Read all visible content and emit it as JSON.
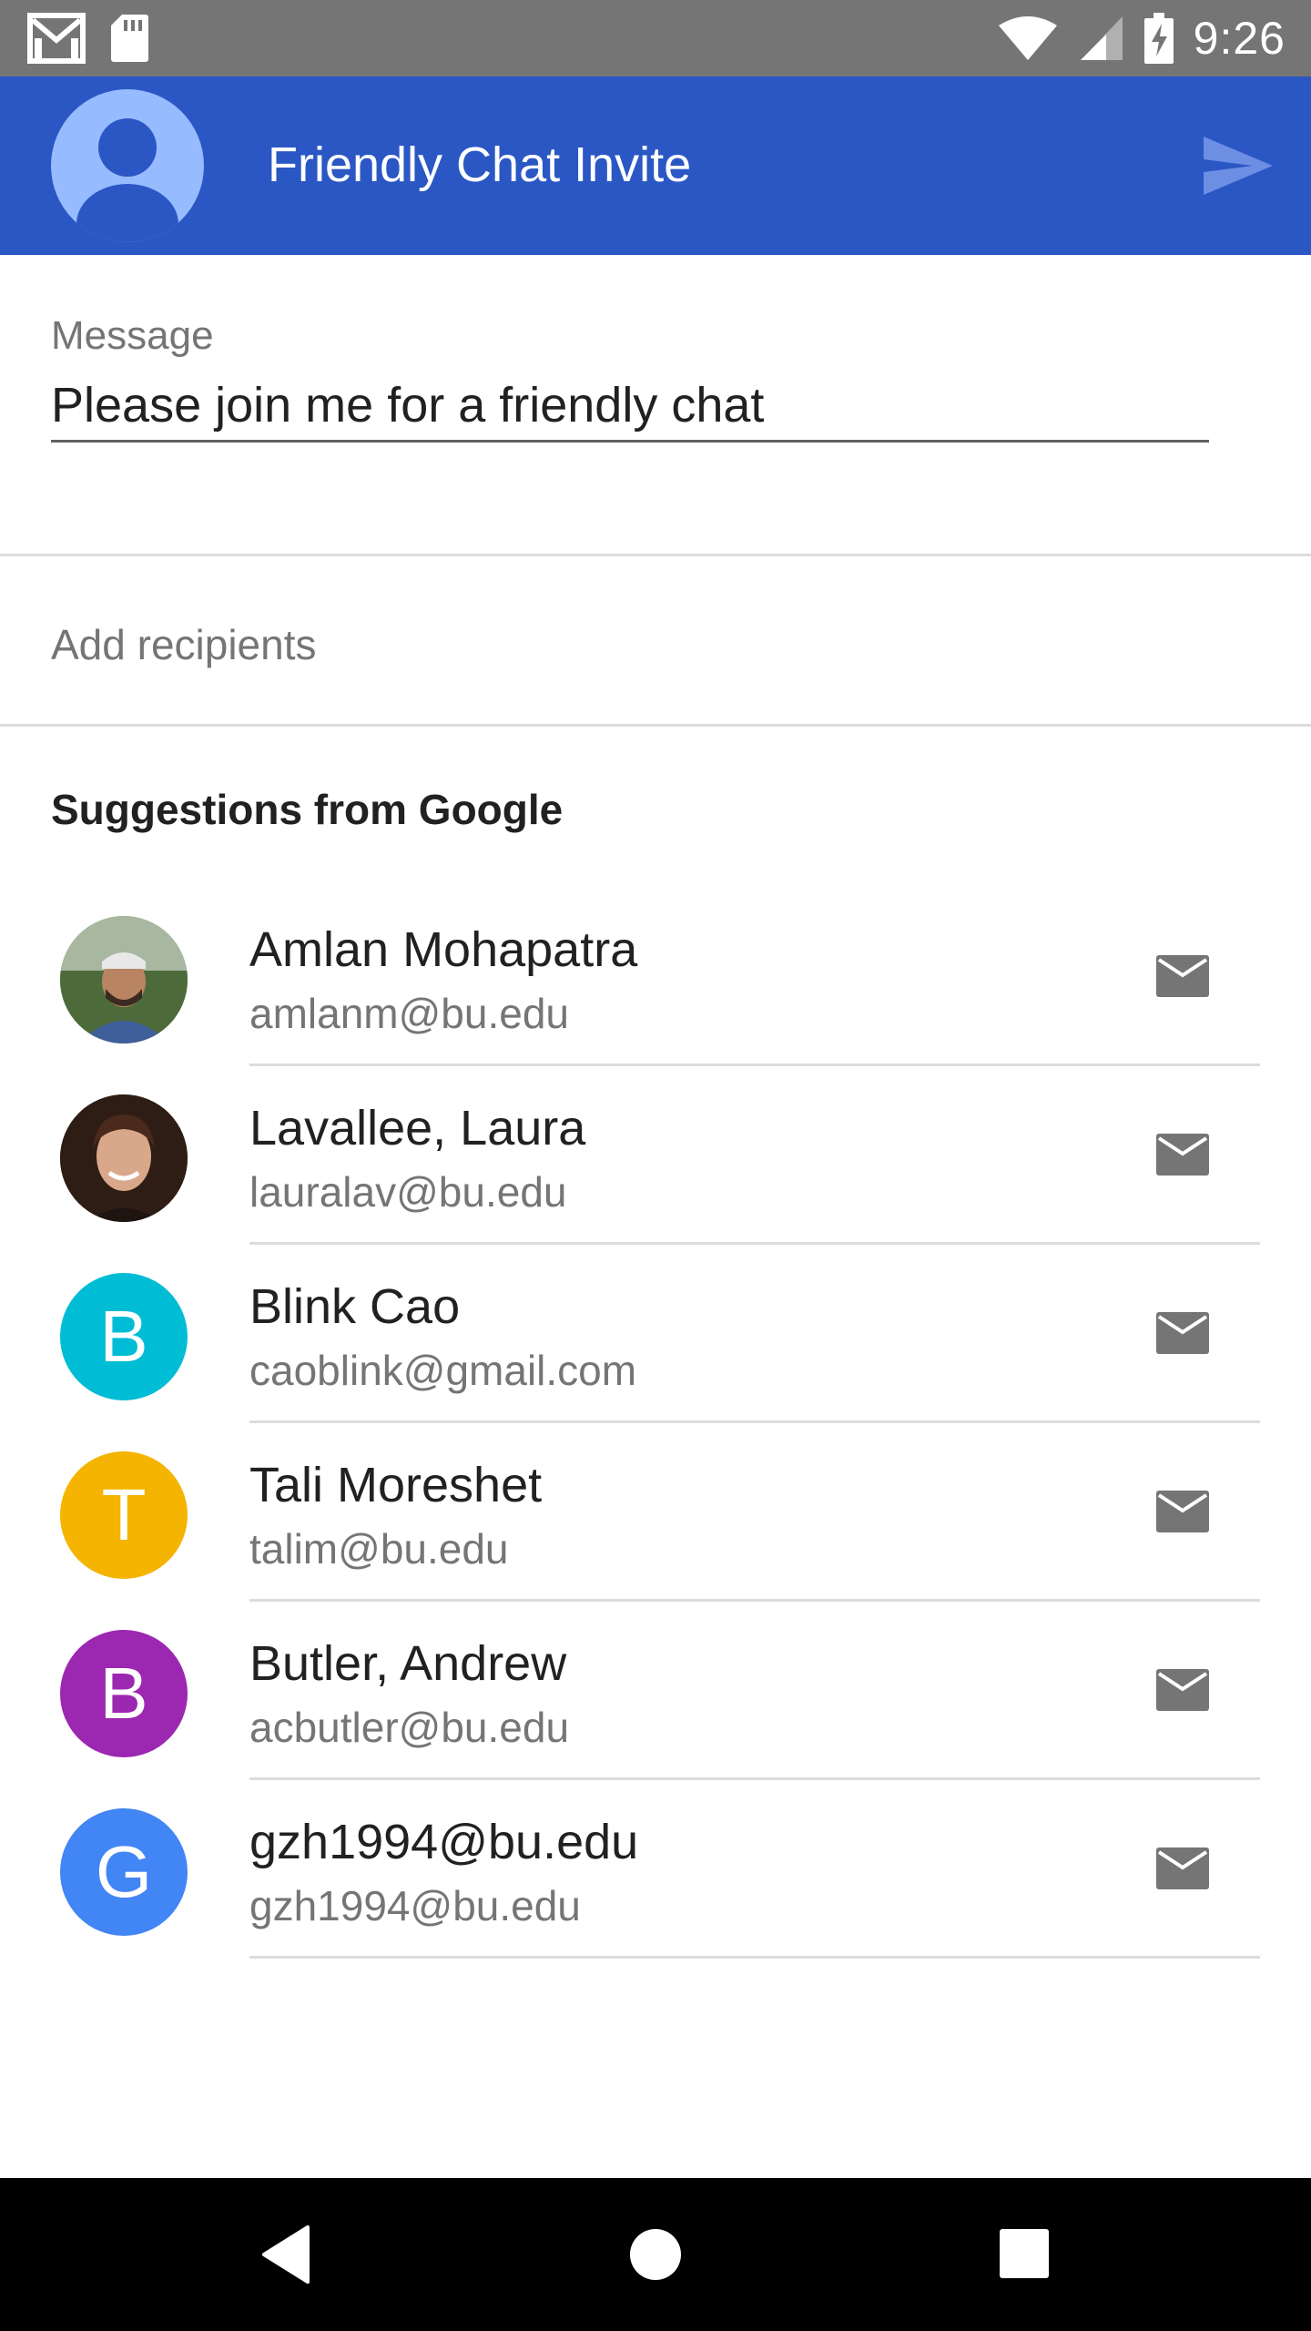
{
  "status_bar": {
    "time": "9:26",
    "left_icons": [
      "gmail-icon",
      "sd-card-icon"
    ],
    "right_icons": [
      "wifi-icon",
      "cell-signal-icon",
      "battery-charging-icon"
    ]
  },
  "app_bar": {
    "title": "Friendly Chat Invite",
    "background": "#2b57c4",
    "avatar_icon": "account-icon",
    "send_icon": "send-icon"
  },
  "message": {
    "label": "Message",
    "value": "Please join me for a friendly chat"
  },
  "recipients": {
    "placeholder": "Add recipients"
  },
  "suggestions": {
    "heading": "Suggestions from Google",
    "items": [
      {
        "name": "Amlan Mohapatra",
        "email": "amlanm@bu.edu",
        "avatar_type": "photo",
        "avatar_letter": "",
        "avatar_color": "#4a6a3a"
      },
      {
        "name": "Lavallee, Laura",
        "email": "lauralav@bu.edu",
        "avatar_type": "photo",
        "avatar_letter": "",
        "avatar_color": "#3a2418"
      },
      {
        "name": "Blink Cao",
        "email": "caoblink@gmail.com",
        "avatar_type": "letter",
        "avatar_letter": "B",
        "avatar_color": "#00bcd4"
      },
      {
        "name": "Tali Moreshet",
        "email": "talim@bu.edu",
        "avatar_type": "letter",
        "avatar_letter": "T",
        "avatar_color": "#f4b400"
      },
      {
        "name": "Butler, Andrew",
        "email": "acbutler@bu.edu",
        "avatar_type": "letter",
        "avatar_letter": "B",
        "avatar_color": "#9c27b0"
      },
      {
        "name": "gzh1994@bu.edu",
        "email": "gzh1994@bu.edu",
        "avatar_type": "letter",
        "avatar_letter": "G",
        "avatar_color": "#4285f4"
      }
    ]
  },
  "nav_bar": {
    "buttons": [
      "back-icon",
      "home-icon",
      "recents-icon"
    ]
  }
}
